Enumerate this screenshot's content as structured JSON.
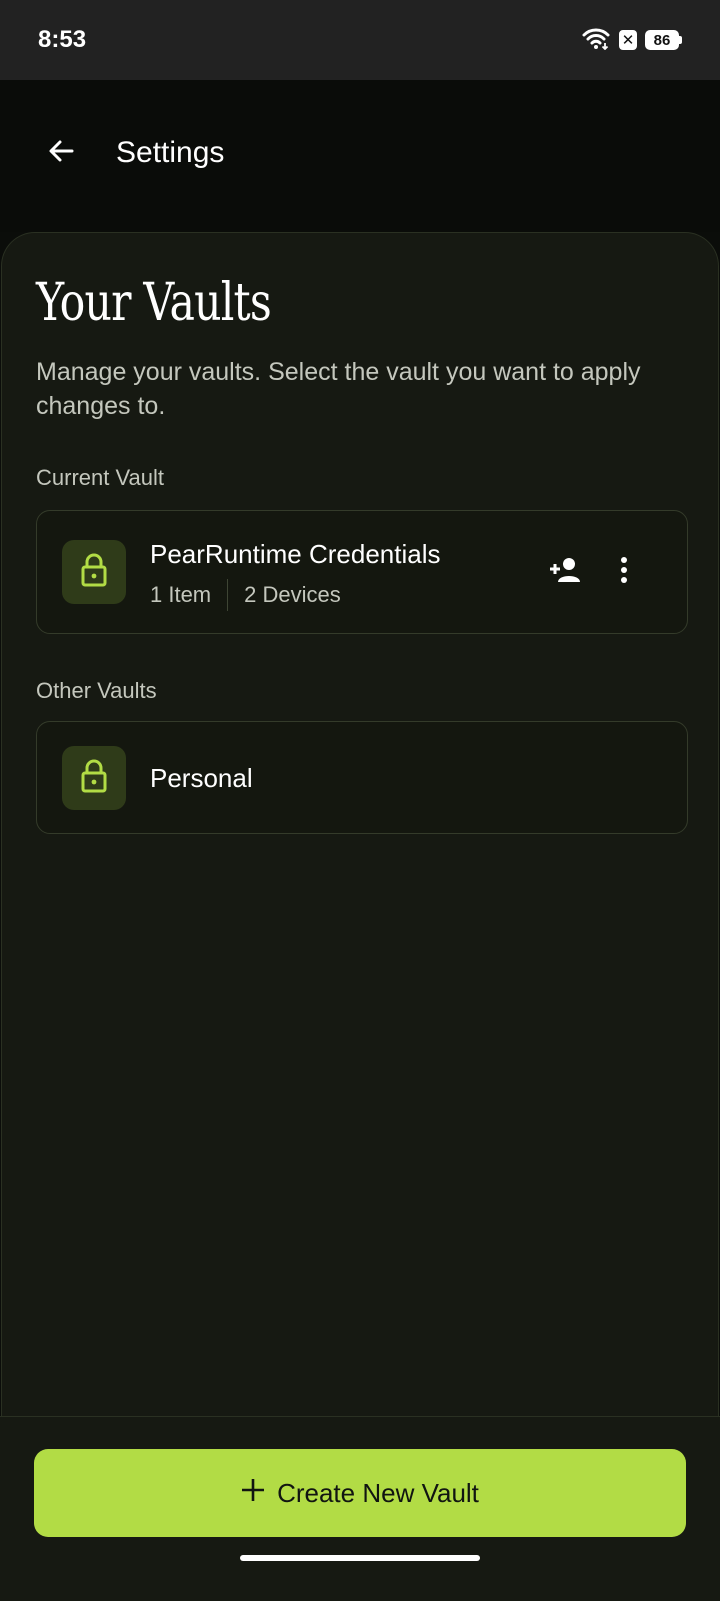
{
  "status_bar": {
    "time": "8:53",
    "battery": "86",
    "icons": [
      "wifi-icon",
      "notification-x-icon",
      "battery-icon"
    ]
  },
  "header": {
    "title": "Settings",
    "back_icon": "arrow-left-icon"
  },
  "page": {
    "title": "Your Vaults",
    "subtitle": "Manage your vaults. Select the vault you want to apply changes to."
  },
  "current_section": {
    "label": "Current Vault",
    "vault": {
      "name": "PearRuntime Credentials",
      "items": "1 Item",
      "devices": "2 Devices",
      "icon": "lock-icon",
      "actions": [
        "add-person-icon",
        "more-vertical-icon"
      ]
    }
  },
  "other_section": {
    "label": "Other Vaults",
    "vaults": [
      {
        "name": "Personal",
        "icon": "lock-icon"
      }
    ]
  },
  "footer": {
    "create_label": "Create New Vault",
    "create_icon": "plus-icon"
  },
  "colors": {
    "accent": "#b2dc45",
    "lock_tile_bg": "#2f3b19",
    "lock_icon": "#b2dc45",
    "panel_bg": "#161912",
    "header_bg": "#0a0c09",
    "muted_text": "#c4c7bd"
  }
}
